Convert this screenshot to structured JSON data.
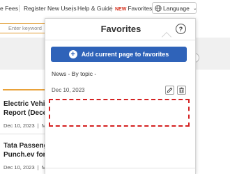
{
  "topnav": {
    "fees": "e Fees",
    "register": "Register New Users",
    "help": "Help & Guide",
    "new_badge": "NEW",
    "favorites": "Favorites",
    "language": "Language"
  },
  "search": {
    "placeholder": "Enter keyword"
  },
  "articles": [
    {
      "title_line1": "Electric Vehicle",
      "title_line2": "Report (Decem",
      "date": "Dec 10, 2023",
      "extra": "Ma"
    },
    {
      "title_line1": "Tata Passenge",
      "title_line2": "Punch.ev for IN",
      "date": "Dec 10, 2023",
      "extra": "Ma"
    }
  ],
  "favorites_panel": {
    "title": "Favorites",
    "help_symbol": "?",
    "add_button_label": "Add current page to favorites",
    "section_label": "News - By topic -",
    "entry_date": "Dec 10, 2023"
  },
  "colors": {
    "accent_blue": "#2f63b9",
    "new_badge_red": "#d6301c",
    "orange_rule": "#e9a23a",
    "placeholder_dash": "#d42020"
  }
}
